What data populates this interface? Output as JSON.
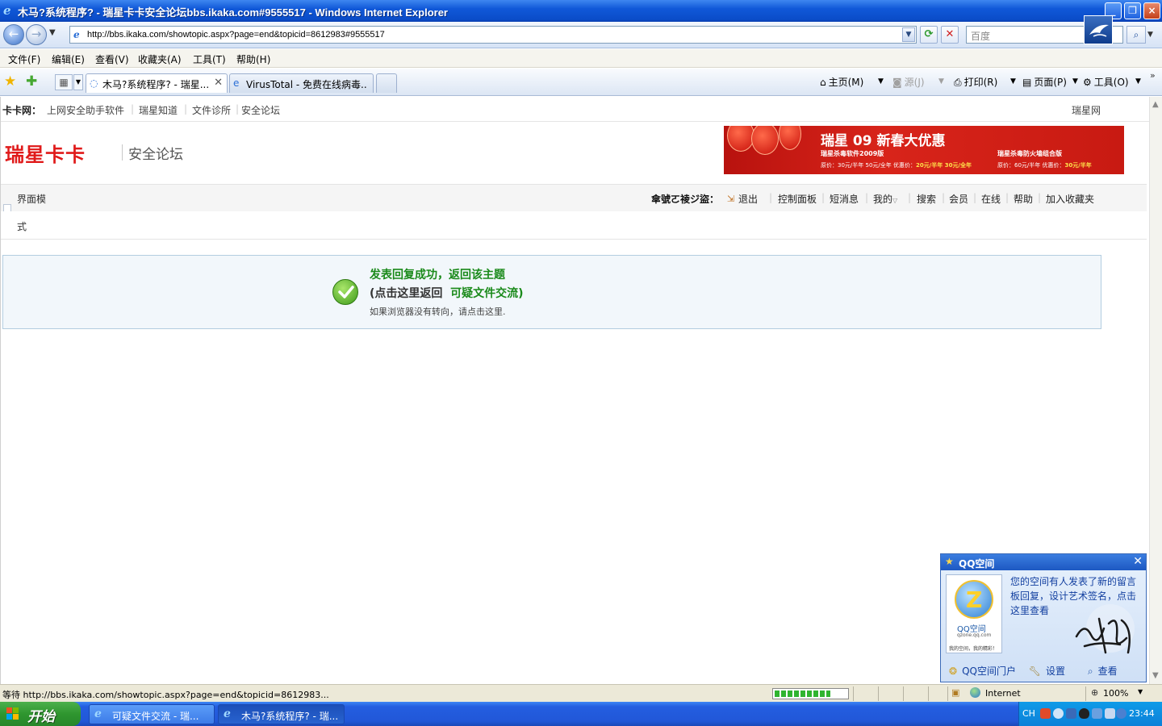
{
  "window": {
    "title": "木马?系统程序? - 瑞星卡卡安全论坛bbs.ikaka.com#9555517 - Windows Internet Explorer",
    "address": "http://bbs.ikaka.com/showtopic.aspx?page=end&topicid=8612983#9555517",
    "search_placeholder": "百度"
  },
  "menu": [
    "文件(F)",
    "编辑(E)",
    "查看(V)",
    "收藏夹(A)",
    "工具(T)",
    "帮助(H)"
  ],
  "tabs": [
    {
      "label": "木马?系统程序? - 瑞星...",
      "active": true
    },
    {
      "label": "VirusTotal - 免费在线病毒...",
      "active": false
    }
  ],
  "commandbar": {
    "home": "主页(M)",
    "feeds": "源(J)",
    "print": "打印(R)",
    "page": "页面(P)",
    "tools": "工具(O)"
  },
  "site": {
    "topnav": {
      "brand": "卡卡网：",
      "links": [
        "上网安全助手软件",
        "瑞星知道",
        "文件诊所",
        "安全论坛"
      ],
      "right": "瑞星网"
    },
    "logo": "瑞星卡卡",
    "logo_sub": "安全论坛",
    "banner": {
      "title": "瑞星 09 新春大优惠",
      "product1": "瑞星杀毒软件2009版",
      "product2": "瑞星杀毒防火墙组合版",
      "price1_orig": "原价：30元/半年 50元/全年",
      "price1_deal_label": "优惠价：",
      "price1_deal": "20元/半年 30元/全年",
      "price2_orig": "原价：60元/半年",
      "price2_deal_label": "优惠价：",
      "price2_deal": "30元/半年"
    },
    "forumbar": {
      "mode_line1": "界面模",
      "mode_line2": "式",
      "username": "傘號ㄛ祾ジ盜",
      "user_colon": "：",
      "links": [
        "退出",
        "控制面板",
        "短消息",
        "我的",
        "搜索",
        "会员",
        "在线",
        "帮助",
        "加入收藏夹"
      ]
    }
  },
  "message": {
    "title": "发表回复成功，返回该主题",
    "back_prefix": "(点击这里返回",
    "back_target": "可疑文件交流)",
    "hint": "如果浏览器没有转向，请点击这里."
  },
  "qq_popup": {
    "title": "QQ空间",
    "logo_text": "QQ空间",
    "logo_site": "qzone.qq.com",
    "logo_motto": "我的空间，我的精彩！",
    "message": "您的空间有人发表了新的留言板回复，设计艺术签名，点击这里查看",
    "footer": [
      "QQ空间门户",
      "设置",
      "查看"
    ]
  },
  "statusbar": {
    "text": "等待 http://bbs.ikaka.com/showtopic.aspx?page=end&topicid=8612983...",
    "progress": 0.78,
    "zone": "Internet",
    "zoom": "100%"
  },
  "taskbar": {
    "start": "开始",
    "tasks": [
      {
        "label": "可疑文件交流 - 瑞...",
        "active": false
      },
      {
        "label": "木马?系统程序? - 瑞...",
        "active": true
      }
    ],
    "lang": "CH",
    "clock": "23:44"
  },
  "colors": {
    "title_bar": "#0a4cc8",
    "success_green": "#1a8a1a",
    "brand_red": "#e01a1a",
    "qq_blue": "#1340a0"
  }
}
